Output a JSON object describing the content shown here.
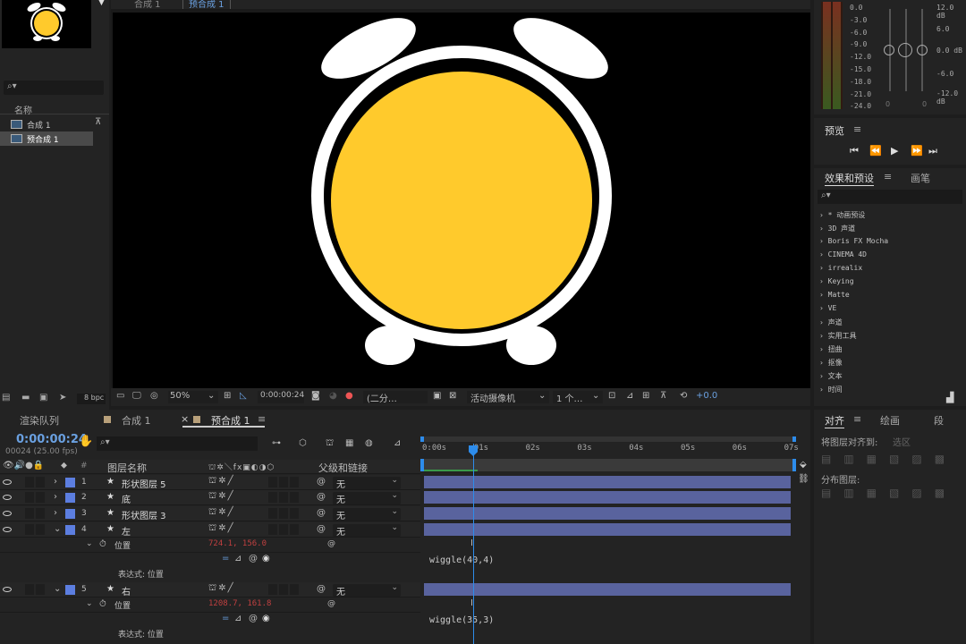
{
  "project": {
    "column_name": "名称",
    "items": [
      {
        "label": "合成 1"
      },
      {
        "label": "预合成 1"
      }
    ],
    "bpc": "8 bpc"
  },
  "viewer": {
    "tabs": [
      "合成 1",
      "预合成 1"
    ],
    "zoom": "50%",
    "timecode": "0:00:00:24",
    "resolution": "(二分…",
    "camera": "活动摄像机",
    "views": "1 个…",
    "exposure": "+0.0"
  },
  "audio": {
    "levels": [
      "0.0",
      "-3.0",
      "-6.0",
      "-9.0",
      "-12.0",
      "-15.0",
      "-18.0",
      "-21.0",
      "-24.0"
    ],
    "db": [
      "12.0 dB",
      "6.0",
      "0.0 dB",
      "-6.0",
      "-12.0 dB"
    ],
    "zeros": [
      "0",
      "0"
    ]
  },
  "preview": {
    "title": "预览",
    "menu": "≡"
  },
  "effects": {
    "title": "效果和预设",
    "menu": "≡",
    "tab2": "画笔",
    "items": [
      "* 动画预设",
      "3D 声道",
      "Boris FX Mocha",
      "CINEMA 4D",
      "irrealix",
      "Keying",
      "Matte",
      "VE",
      "声道",
      "实用工具",
      "扭曲",
      "抠像",
      "文本",
      "时间"
    ]
  },
  "align": {
    "tabs": [
      "对齐",
      "绘画",
      "段"
    ],
    "menu": "≡",
    "align_to_label": "将图层对齐到:",
    "align_to_value": "选区",
    "distribute_label": "分布图层:"
  },
  "timeline": {
    "tabs": [
      "渲染队列",
      "合成 1",
      "预合成 1"
    ],
    "menu": "≡",
    "timecode": "0:00:00:24",
    "frame_info": "00024 (25.00 fps)",
    "col_layer_name": "图层名称",
    "col_parent": "父级和链接",
    "ruler": [
      "0:00s",
      "01s",
      "02s",
      "03s",
      "04s",
      "05s",
      "06s",
      "07s"
    ],
    "layers": [
      {
        "num": "1",
        "name": "形状图层 5",
        "parent": "无"
      },
      {
        "num": "2",
        "name": "底",
        "parent": "无"
      },
      {
        "num": "3",
        "name": "形状图层 3",
        "parent": "无"
      },
      {
        "num": "4",
        "name": "左",
        "parent": "无",
        "position": "724.1, 156.0",
        "expr_label": "表达式: 位置",
        "expr": "wiggle(40,4)"
      },
      {
        "num": "5",
        "name": "右",
        "parent": "无",
        "position": "1208.7, 161.8",
        "expr_label": "表达式: 位置",
        "expr": "wiggle(35,3)"
      }
    ],
    "prop_label": "位置"
  },
  "colors": {
    "face": "#FFCA2C",
    "layer_bar": "#59639E",
    "accent_blue": "#2d8ceb",
    "position_red": "#c04040"
  }
}
